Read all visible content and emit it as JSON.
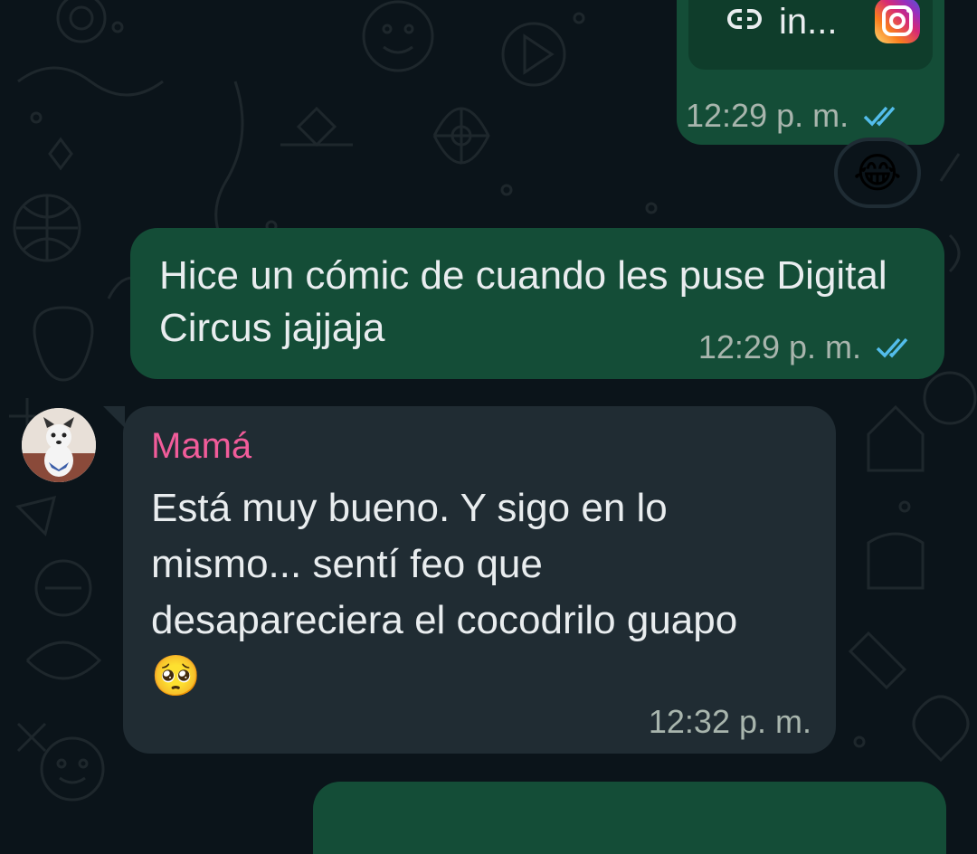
{
  "messages": [
    {
      "direction": "outgoing",
      "link_text": "in...",
      "link_icon": "link-icon",
      "app_icon": "instagram-icon",
      "time": "12:29 p. m.",
      "status": "read",
      "reaction": "😂"
    },
    {
      "direction": "outgoing",
      "text": "Hice un cómic de cuando les puse Digital Circus jajjaja",
      "time": "12:29 p. m.",
      "status": "read"
    },
    {
      "direction": "incoming",
      "sender": "Mamá",
      "text": "Está muy bueno. Y sigo en lo mismo... sentí feo que desapareciera el cocodrilo guapo 🥺",
      "time": "12:32 p. m."
    }
  ],
  "colors": {
    "background": "#0b141a",
    "outgoing_bubble": "#144d37",
    "incoming_bubble": "#202c33",
    "read_ticks": "#53bdeb",
    "sender_name": "#f15c9a"
  }
}
